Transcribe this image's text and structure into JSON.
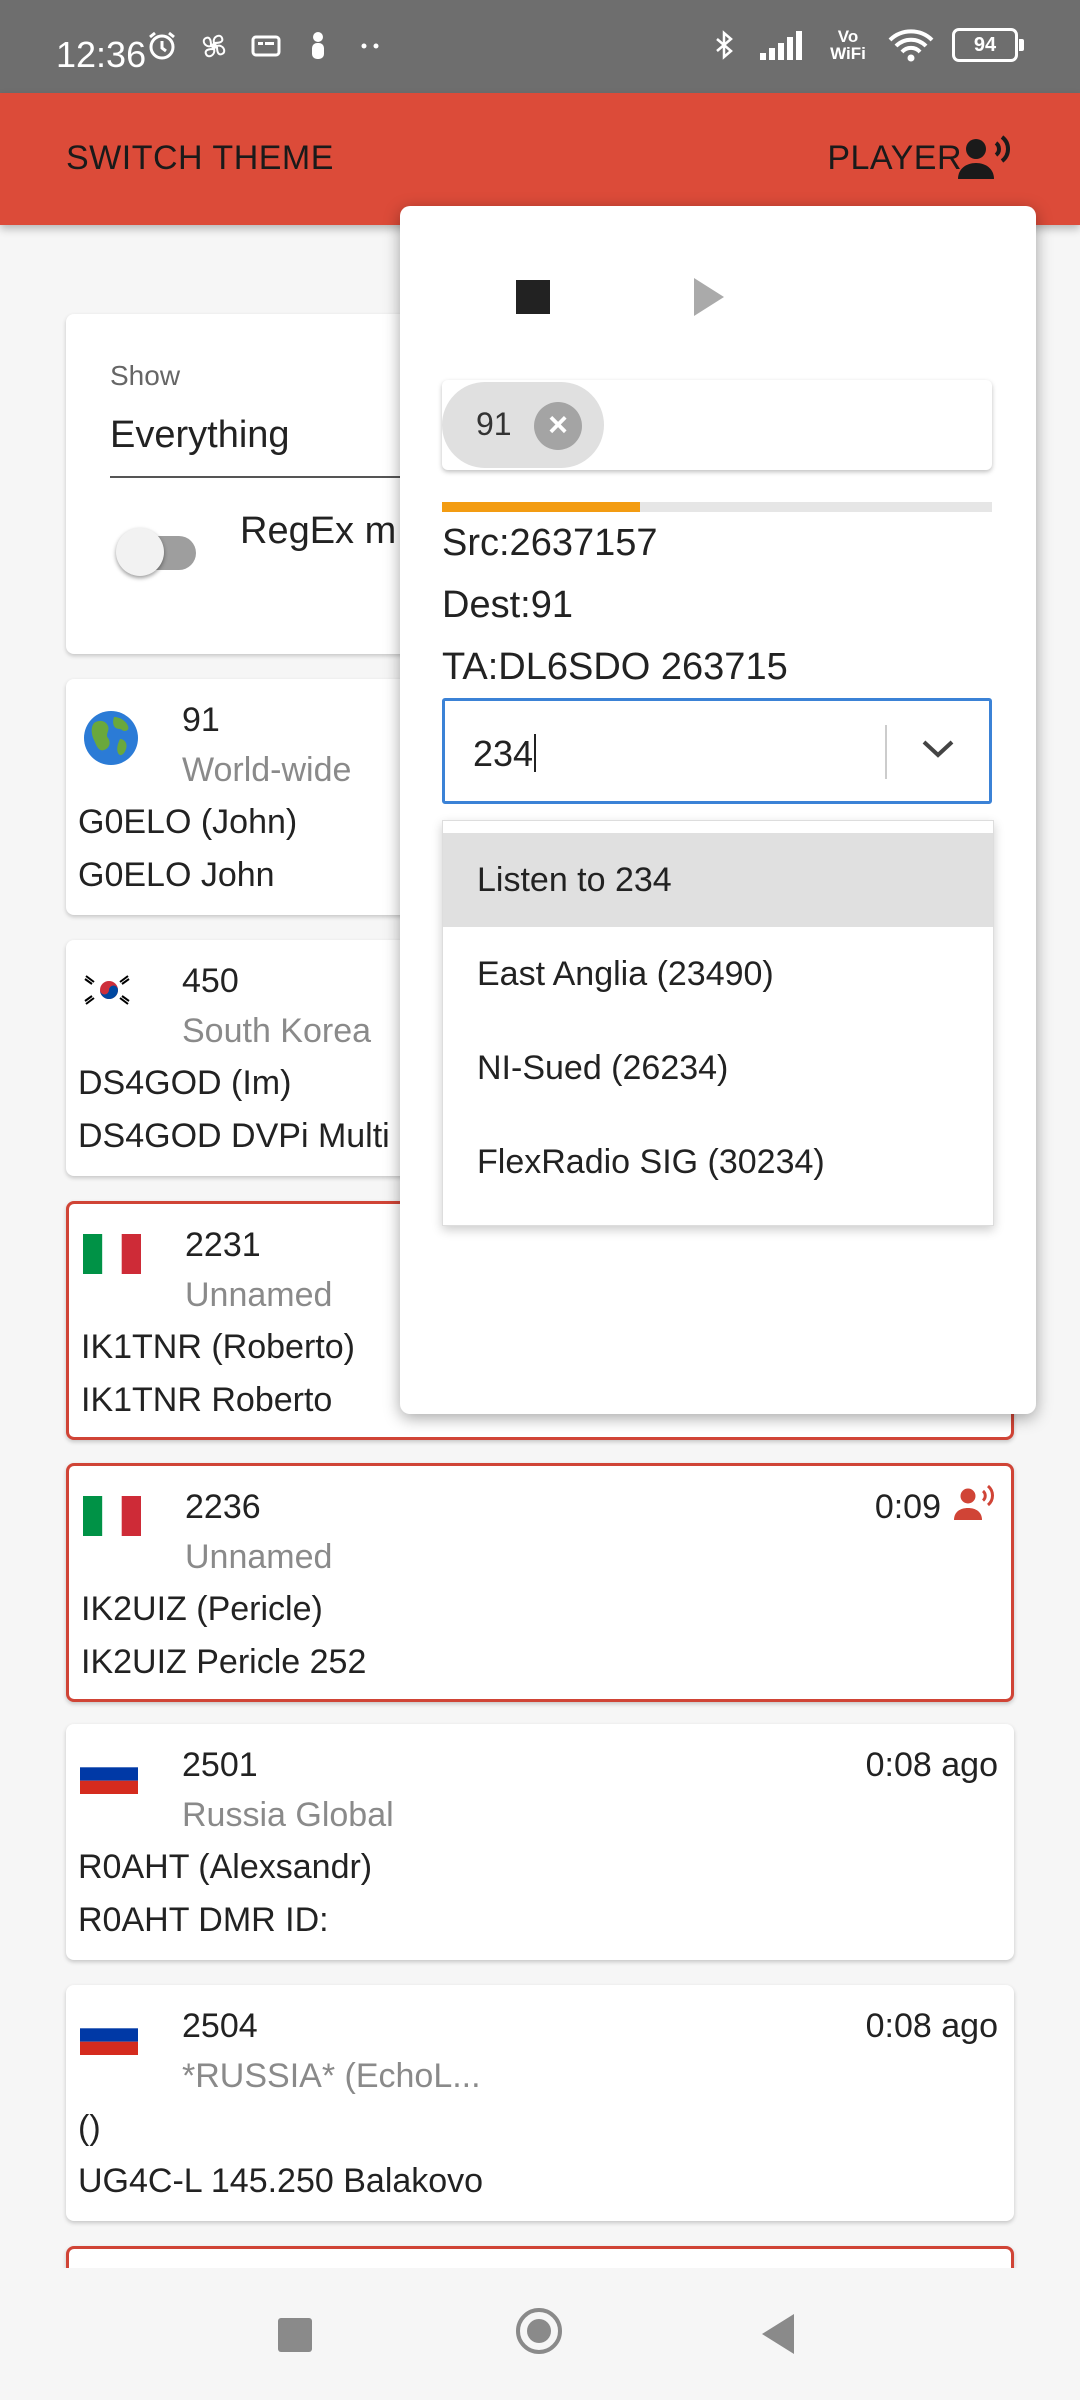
{
  "status_bar": {
    "time": "12:36",
    "battery": "94",
    "left_icons": [
      "alarm-icon",
      "fan-icon",
      "sim-icon",
      "person-icon",
      "more-dots-icon"
    ],
    "right_icons": [
      "bluetooth-icon",
      "signal-icon",
      "vowifi-icon",
      "wifi-icon",
      "battery-icon"
    ],
    "vowifi_text": "Vo WiFi"
  },
  "app_bar": {
    "switch_theme_label": "SWITCH THEME",
    "player_label": "PLAYER",
    "player_icon": "record-voice-icon",
    "color": "#dc4b39"
  },
  "filter": {
    "show_label": "Show",
    "show_value": "Everything",
    "regex_label": "RegEx m",
    "regex_enabled": false
  },
  "talkgroups": [
    {
      "id": "91",
      "name": "World-wide",
      "line1": "G0ELO (John)",
      "line2": "G0ELO John",
      "flag": "globe-icon",
      "time": "",
      "active": false
    },
    {
      "id": "450",
      "name": "South Korea",
      "line1": "DS4GOD (Im)",
      "line2": "DS4GOD DVPi Multi",
      "flag": "south-korea-flag-icon",
      "time": "",
      "active": false
    },
    {
      "id": "2231",
      "name": "Unnamed",
      "line1": "IK1TNR (Roberto)",
      "line2": "IK1TNR Roberto",
      "flag": "italy-flag-icon",
      "time": "",
      "active": true
    },
    {
      "id": "2236",
      "name": "Unnamed",
      "line1": "IK2UIZ (Pericle)",
      "line2": "IK2UIZ Pericle 252",
      "flag": "italy-flag-icon",
      "time": "0:09",
      "active": true
    },
    {
      "id": "2501",
      "name": "Russia Global",
      "line1": "R0AHT (Alexsandr)",
      "line2": "R0AHT DMR ID:",
      "flag": "russia-flag-icon",
      "time": "0:08 ago",
      "active": false
    },
    {
      "id": "2504",
      "name": "*RUSSIA* (EchoL...",
      "line1": "()",
      "line2": "UG4C-L 145.250 Balakovo",
      "flag": "russia-flag-icon",
      "time": "0:08 ago",
      "active": false
    }
  ],
  "player": {
    "stop_icon": "stop-icon",
    "play_icon": "play-icon",
    "chip_label": "91",
    "progress": 0.36,
    "src": "Src:2637157",
    "dest": "Dest:91",
    "ta": "TA:DL6SDO 263715",
    "search_value": "234",
    "options": [
      {
        "label": "Listen to 234",
        "selected": true
      },
      {
        "label": "East Anglia (23490)",
        "selected": false
      },
      {
        "label": "NI-Sued (26234)",
        "selected": false
      },
      {
        "label": "FlexRadio SIG (30234)",
        "selected": false
      }
    ]
  },
  "nav_bar": {
    "icons": [
      "recents-icon",
      "home-icon",
      "back-icon"
    ]
  }
}
